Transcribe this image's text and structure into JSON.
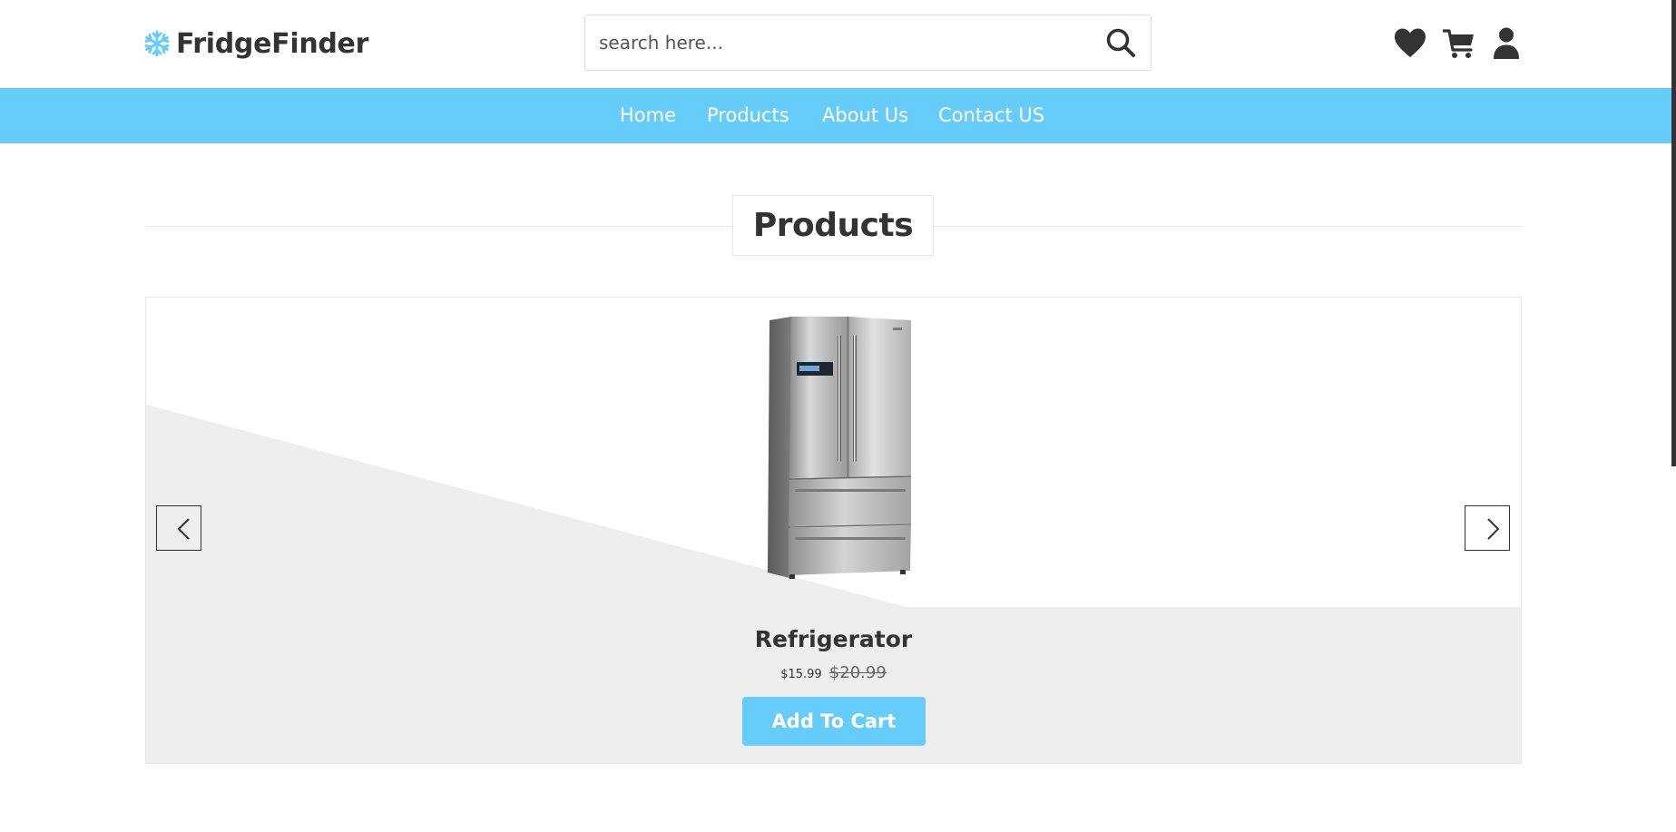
{
  "header": {
    "logo": {
      "icon": "snowflake-icon",
      "text": "FridgeFinder",
      "icon_color": "#66cdfa"
    },
    "search": {
      "placeholder": "search here...",
      "value": "",
      "icon": "search-icon"
    },
    "icons": [
      "heart-icon",
      "cart-icon",
      "user-icon"
    ]
  },
  "navbar": {
    "background": "#66cdfa",
    "links": [
      {
        "label": "Home"
      },
      {
        "label": "Products"
      },
      {
        "label": "About Us"
      },
      {
        "label": "Contact US"
      }
    ]
  },
  "section": {
    "heading": "Products"
  },
  "slider": {
    "prev_icon": "chevron-left-icon",
    "next_icon": "chevron-right-icon",
    "product": {
      "image": "refrigerator-image",
      "name": "Refrigerator",
      "price": "$15.99",
      "old_price": "$20.99",
      "button_label": "Add To Cart"
    }
  },
  "colors": {
    "accent": "#66cdfa",
    "text": "#333333",
    "slide_shade": "#eeeeee"
  }
}
